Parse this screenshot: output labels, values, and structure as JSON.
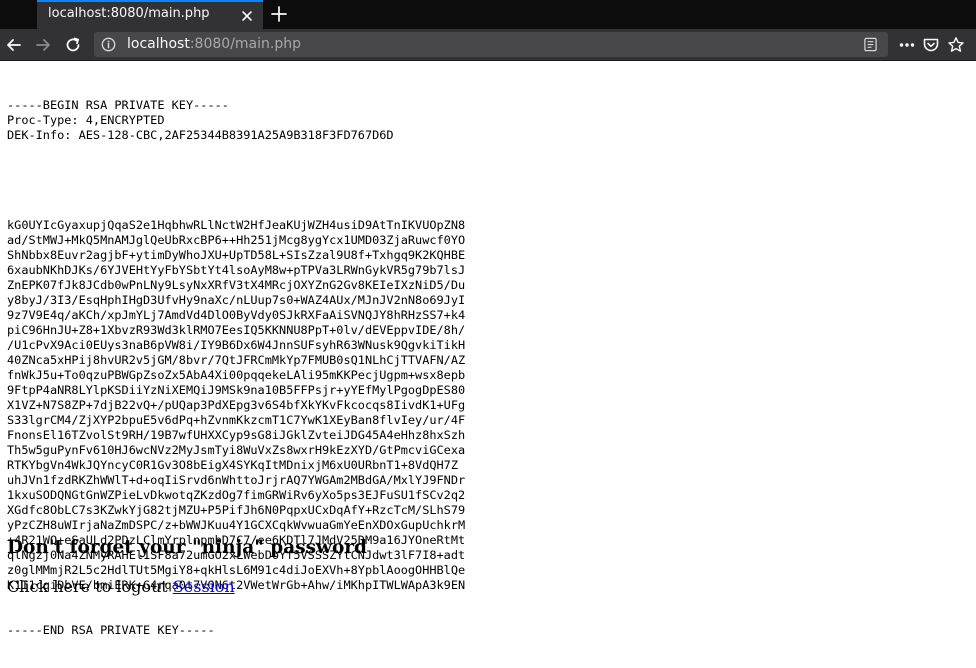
{
  "browser": {
    "tab": {
      "title": "localhost:8080/main.php"
    },
    "urlbar": {
      "host": "localhost",
      "rest": ":8080/main.php"
    },
    "icons": {
      "tab_close": "close-icon",
      "new_tab": "plus-icon",
      "back": "back-arrow-icon",
      "forward": "forward-arrow-icon",
      "reload": "reload-icon",
      "info": "info-icon",
      "reader": "reader-view-icon",
      "page_actions": "more-dots-icon",
      "pocket": "pocket-icon",
      "bookmark": "star-icon"
    }
  },
  "page": {
    "key_header": [
      "-----BEGIN RSA PRIVATE KEY-----",
      "Proc-Type: 4,ENCRYPTED",
      "DEK-Info: AES-128-CBC,2AF25344B8391A25A9B318F3FD767D6D"
    ],
    "key_body": [
      "kG0UYIcGyaxupjQqaS2e1HqbhwRLlNctW2HfJeaKUjWZH4usiD9AtTnIKVUOpZN8",
      "ad/StMWJ+MkQ5MnAMJglQeUbRxcBP6++Hh251jMcg8ygYcx1UMD03ZjaRuwcf0YO",
      "ShNbbx8Euvr2agjbF+ytimDyWhoJXU+UpTD58L+SIsZzal9U8f+Txhgq9K2KQHBE",
      "6xaubNKhDJKs/6YJVEHtYyFbYSbtYt4lsoAyM8w+pTPVa3LRWnGykVR5g79b7lsJ",
      "ZnEPK07fJk8JCdb0wPnLNy9LsyNxXRfV3tX4MRcjOXYZnG2Gv8KEIeIXzNiD5/Du",
      "y8byJ/3I3/EsqHphIHgD3UfvHy9naXc/nLUup7s0+WAZ4AUx/MJnJV2nN8o69JyI",
      "9z7V9E4q/aKCh/xpJmYLj7AmdVd4DlO0ByVdy0SJkRXFaAiSVNQJY8hRHzSS7+k4",
      "piC96HnJU+Z8+1XbvzR93Wd3klRMO7EesIQ5KKNNU8PpT+0lv/dEVEppvIDE/8h/",
      "/U1cPvX9Aci0EUys3naB6pVW8i/IY9B6Dx6W4JnnSUFsyhR63WNusk9QgvkiTikH",
      "40ZNca5xHPij8hvUR2v5jGM/8bvr/7QtJFRCmMkYp7FMUB0sQ1NLhCjTTVAFN/AZ",
      "fnWkJ5u+To0qzuPBWGpZsoZx5AbA4Xi00pqqekeLAli95mKKPecjUgpm+wsx8epb",
      "9FtpP4aNR8LYlpKSDiiYzNiXEMQiJ9MSk9na10B5FFPsjr+yYEfMylPgogDpES80",
      "X1VZ+N7S8ZP+7djB22vQ+/pUQap3PdXEpg3v6S4bfXkYKvFkcocqs8IivdK1+UFg",
      "S33lgrCM4/ZjXYP2bpuE5v6dPq+hZvnmKkzcmT1C7YwK1XEyBan8flvIey/ur/4F",
      "FnonsEl16TZvolSt9RH/19B7wfUHXXCyp9sG8iJGklZvteiJDG45A4eHhz8hxSzh",
      "Th5w5guPynFv610HJ6wcNVz2MyJsmTyi8WuVxZs8wxrH9kEzXYD/GtPmcviGCexa",
      "RTKYbgVn4WkJQYncyC0R1Gv3O8bEigX4SYKqItMDnixjM6xU0URbnT1+8VdQH7Z",
      "uhJVn1fzdRKZhWWlT+d+oqIiSrvd6nWhttoJrjrAQ7YWGAm2MBdGA/MxlYJ9FNDr",
      "1kxuSODQNGtGnWZPieLvDkwotqZKzdOg7fimGRWiRv6yXo5ps3EJFuSU1fSCv2q2",
      "XGdfc8ObLC7s3KZwkYjG82tjMZU+P5PifJh6N0PqpxUCxDqAfY+RzcTcM/SLhS79",
      "yPzCZH8uWIrjaNaZmDSPC/z+bWWJKuu4Y1GCXCqkWvwuaGmYeEnXDOxGupUchkrM",
      "+4R21WQ+eSaULd2PDzLClmYrplnpmbD7C7/ee6KDTl7JMdV25DM9a16JYOneRtMt",
      "qlNgzj0Na4ZNMyRAHEl1SF8a72umGO2xLWebDoYf5VSSSZYtCNJdwt3lF7I8+adt",
      "z0glMMmjR2L5c2HdlTUt5MgiY8+qkHlsL6M91c4diJoEXVh+8YpblAoogOHHBlQe",
      "K1I1cqiDbVE/bmiERK+G4rqa0t7VQN6t2VWetWrGb+Ahw/iMKhpITWLWApA3k9EN"
    ],
    "key_footer": "-----END RSA PRIVATE KEY-----",
    "heading": "Don't forget your \"ninja\" password",
    "logout_text": "Click here to logout ",
    "logout_link": "Session"
  }
}
